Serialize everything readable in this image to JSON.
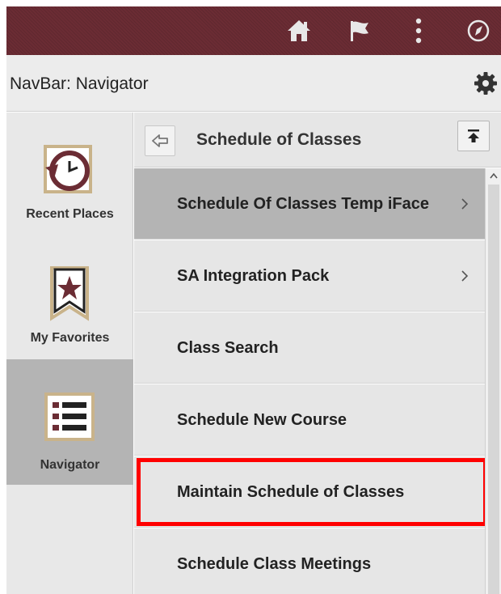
{
  "topbar": {
    "color": "#6b2c34",
    "icons": [
      "home-icon",
      "flag-icon",
      "more-vertical-icon",
      "compass-icon"
    ]
  },
  "header": {
    "title": "NavBar: Navigator",
    "gear_icon": "gear-icon"
  },
  "rail": {
    "items": [
      {
        "label": "Recent Places",
        "icon": "recent-places-icon"
      },
      {
        "label": "My Favorites",
        "icon": "favorites-icon"
      },
      {
        "label": "Navigator",
        "icon": "navigator-icon",
        "active": true
      }
    ]
  },
  "panel": {
    "back_icon": "back-arrow-icon",
    "title": "Schedule of Classes",
    "top_icon": "scroll-to-top-icon"
  },
  "menu": {
    "items": [
      {
        "label": "Schedule Of Classes Temp iFace",
        "has_children": true,
        "highlighted": true
      },
      {
        "label": "SA Integration Pack",
        "has_children": true
      },
      {
        "label": "Class Search",
        "has_children": false
      },
      {
        "label": "Schedule New Course",
        "has_children": false
      },
      {
        "label": "Maintain Schedule of Classes",
        "has_children": false,
        "focused": true
      },
      {
        "label": "Schedule Class Meetings",
        "has_children": false
      }
    ]
  },
  "colors": {
    "brand": "#6b2c34",
    "focus_outline": "#ff0000",
    "active_bg": "#b4b4b4"
  }
}
